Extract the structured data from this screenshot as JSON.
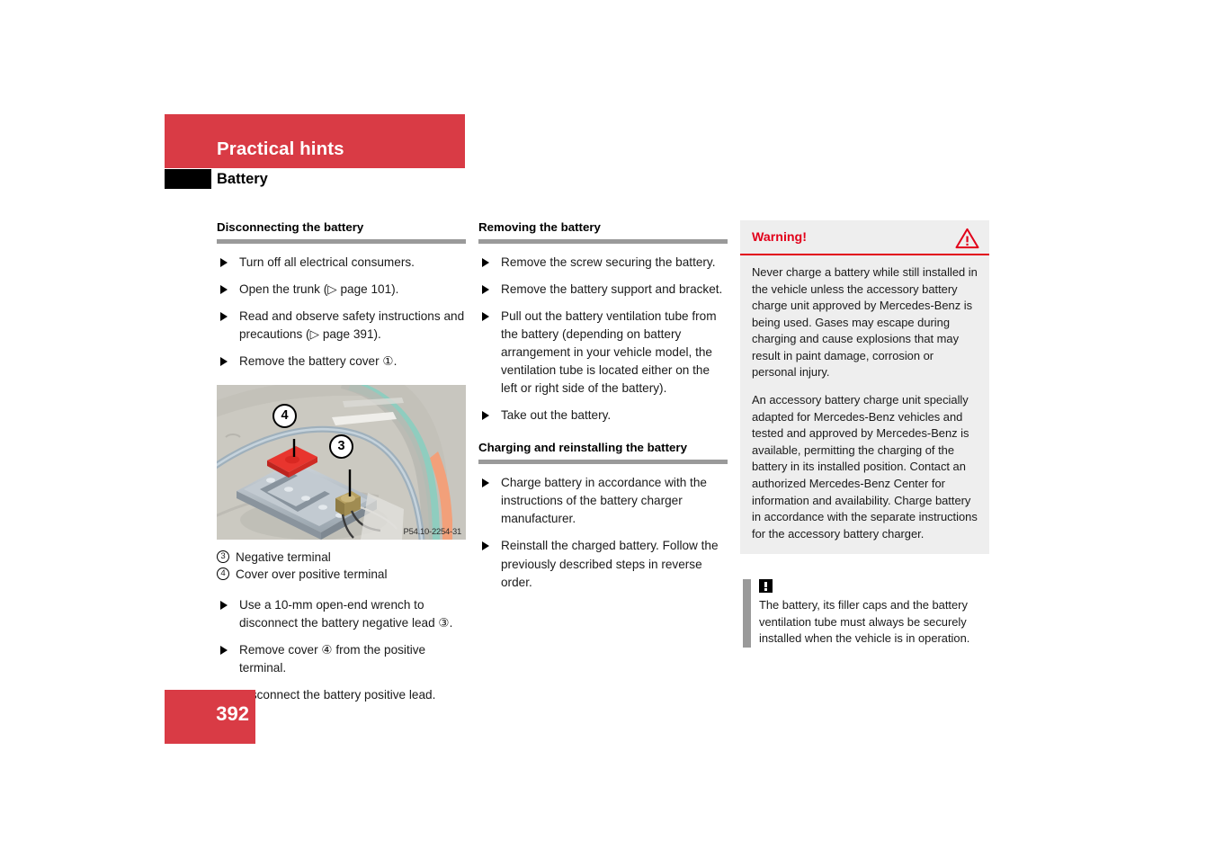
{
  "header": {
    "chapter_title": "Practical hints",
    "section_title": "Battery"
  },
  "page_number": "392",
  "columns": {
    "col1": {
      "heading": "Disconnecting the battery",
      "steps": [
        "Turn off all electrical consumers.",
        "Open the trunk (▷ page 101).",
        "Read and observe safety instructions and precautions (▷ page 391).",
        "Remove the battery cover ①."
      ],
      "figure": {
        "code": "P54.10-2254-31",
        "callouts": [
          {
            "number": "4",
            "label": "Cover over positive terminal"
          },
          {
            "number": "3",
            "label": "Negative terminal"
          }
        ]
      },
      "legend": [
        {
          "number": "3",
          "text": "Negative terminal"
        },
        {
          "number": "4",
          "text": "Cover over positive terminal"
        }
      ],
      "steps_after_figure": [
        "Use a 10-mm open-end wrench to disconnect the battery negative lead ③.",
        "Remove cover ④ from the positive terminal.",
        "Disconnect the battery positive lead."
      ]
    },
    "col2": {
      "heading1": "Removing the battery",
      "steps1": [
        "Remove the screw securing the battery.",
        "Remove the battery support and bracket.",
        "Pull out the battery ventilation tube from the battery (depending on battery arrangement in your vehicle model, the ventilation tube is located either on the left or right side of the battery).",
        "Take out the battery."
      ],
      "heading2": "Charging and reinstalling the battery",
      "steps2": [
        "Charge battery in accordance with the instructions of the battery charger manufacturer.",
        "Reinstall the charged battery. Follow the previously described steps in reverse order."
      ]
    },
    "col3": {
      "warning": {
        "title": "Warning!",
        "icon": "warning-triangle-icon",
        "paragraphs": [
          "Never charge a battery while still installed in the vehicle unless the accessory battery charge unit approved by Mercedes-Benz is being used. Gases may escape during charging and cause explosions that may result in paint damage, corrosion or personal injury.",
          "An accessory battery charge unit specially adapted for Mercedes-Benz vehicles and tested and approved by Mercedes-Benz is available, permitting the charging of the battery in its installed position. Contact an authorized Mercedes-Benz Center for information and availability. Charge battery in accordance with the separate instructions for the accessory battery charger."
        ]
      },
      "note": {
        "icon": "exclamation-note-icon",
        "text": "The battery, its filler caps and the battery ventilation tube must always be securely installed when the vehicle is in operation."
      }
    }
  },
  "colors": {
    "brand_red": "#d93b45",
    "warning_red": "#e2001a",
    "rule_gray": "#9a9a9a",
    "box_gray": "#eeeeee"
  }
}
